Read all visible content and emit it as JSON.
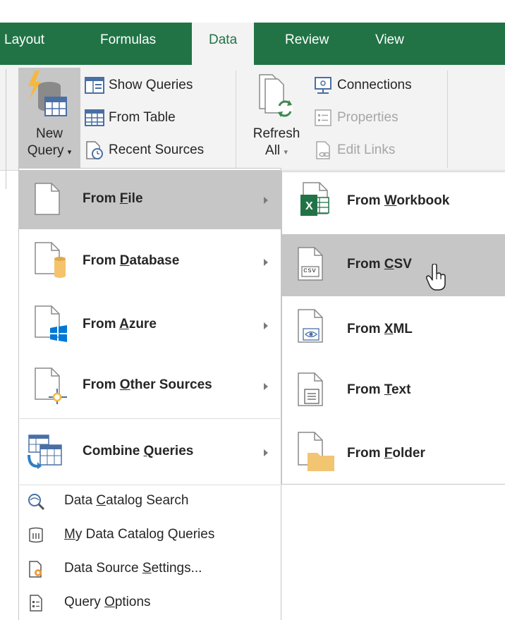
{
  "ribbon": {
    "tabs": [
      {
        "label": "Layout"
      },
      {
        "label": "Formulas"
      },
      {
        "label": "Data"
      },
      {
        "label": "Review"
      },
      {
        "label": "View"
      }
    ],
    "active_tab": "Data",
    "new_query": {
      "line1": "New",
      "line2": "Query"
    },
    "show_queries": "Show Queries",
    "from_table": "From Table",
    "recent_sources": "Recent Sources",
    "refresh_all": {
      "line1": "Refresh",
      "line2": "All"
    },
    "connections": "Connections",
    "properties": "Properties",
    "edit_links": "Edit Links"
  },
  "menu": {
    "items": [
      {
        "pre": "From ",
        "key": "F",
        "post": "ile"
      },
      {
        "pre": "From ",
        "key": "D",
        "post": "atabase"
      },
      {
        "pre": "From ",
        "key": "A",
        "post": "zure"
      },
      {
        "pre": "From ",
        "key": "O",
        "post": "ther Sources"
      },
      {
        "pre": "Combine ",
        "key": "Q",
        "post": "ueries"
      }
    ],
    "small_items": [
      {
        "pre": "Data ",
        "key": "C",
        "post": "atalog Search"
      },
      {
        "pre": "",
        "key": "M",
        "post": "y Data Catalog Queries"
      },
      {
        "pre": "Data Source ",
        "key": "S",
        "post": "ettings..."
      },
      {
        "pre": "Query ",
        "key": "O",
        "post": "ptions"
      }
    ]
  },
  "submenu": {
    "items": [
      {
        "pre": "From ",
        "key": "W",
        "post": "orkbook"
      },
      {
        "pre": "From ",
        "key": "C",
        "post": "SV"
      },
      {
        "pre": "From ",
        "key": "X",
        "post": "ML"
      },
      {
        "pre": "From ",
        "key": "T",
        "post": "ext"
      },
      {
        "pre": "From ",
        "key": "F",
        "post": "older"
      }
    ],
    "csv_badge": "csv",
    "xl_badge": "X"
  },
  "colors": {
    "excel_green": "#217346",
    "highlight": "#c6c6c6",
    "folder": "#f2c572",
    "cylinder": "#f5c36b",
    "azure_blue": "#0078d7"
  }
}
